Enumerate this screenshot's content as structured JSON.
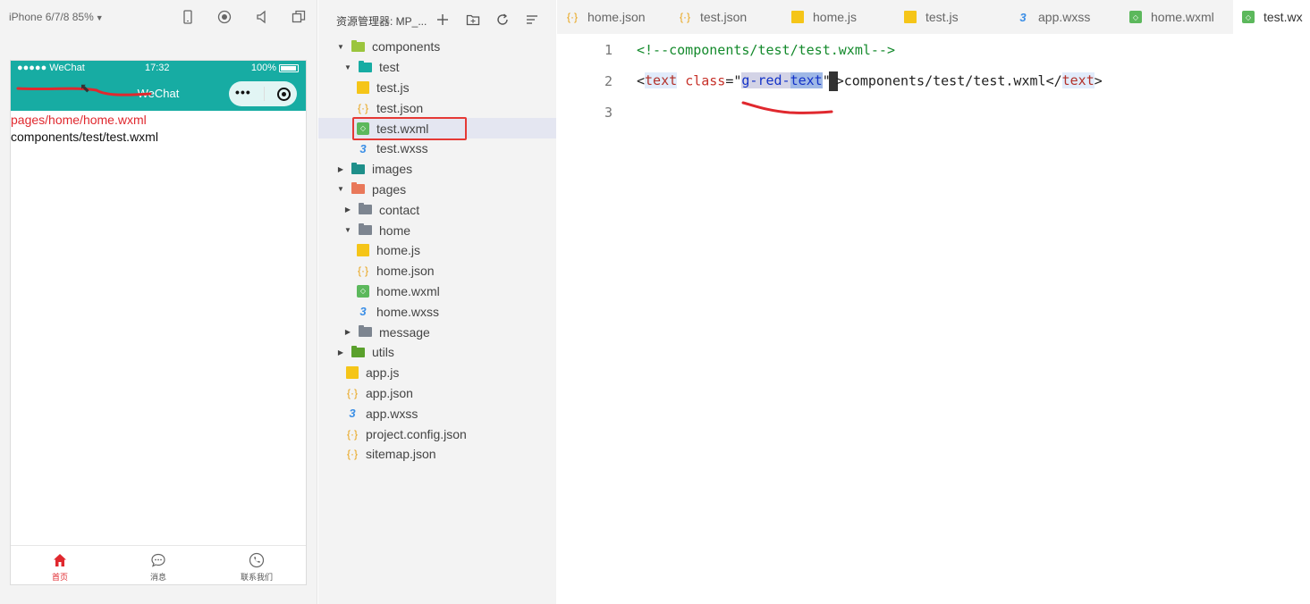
{
  "simulator": {
    "device": "iPhone 6/7/8 85%",
    "status_bar": {
      "carrier": "●●●●● WeChat",
      "time": "17:32",
      "battery": "100%"
    },
    "nav_title": "WeChat",
    "content_lines": [
      "pages/home/home.wxml",
      "components/test/test.wxml"
    ],
    "tabbar": [
      {
        "label": "首页",
        "icon": "home-icon",
        "active": true
      },
      {
        "label": "消息",
        "icon": "chat-bubble-icon",
        "active": false
      },
      {
        "label": "联系我们",
        "icon": "phone-icon",
        "active": false
      }
    ],
    "colors": {
      "nav_bg": "#17aca3",
      "active_tab": "#e0282e",
      "red_text": "#e0282e"
    }
  },
  "explorer": {
    "title": "资源管理器: MP_...",
    "tree": [
      {
        "label": "components",
        "type": "folder",
        "folder_color": "#9bc53d",
        "depth": 0,
        "twisty": "open"
      },
      {
        "label": "test",
        "type": "folder",
        "folder_color": "#17aca3",
        "depth": 1,
        "twisty": "open"
      },
      {
        "label": "test.js",
        "type": "js",
        "depth": 2
      },
      {
        "label": "test.json",
        "type": "json",
        "depth": 2
      },
      {
        "label": "test.wxml",
        "type": "wxml",
        "depth": 2,
        "selected": true
      },
      {
        "label": "test.wxss",
        "type": "wxss",
        "depth": 2
      },
      {
        "label": "images",
        "type": "folder",
        "folder_color": "#1e8f8a",
        "depth": 0,
        "twisty": "closed"
      },
      {
        "label": "pages",
        "type": "folder",
        "folder_color": "#e9785a",
        "depth": 0,
        "twisty": "open"
      },
      {
        "label": "contact",
        "type": "folder",
        "folder_color": "#7d8590",
        "depth": 1,
        "twisty": "closed"
      },
      {
        "label": "home",
        "type": "folder",
        "folder_color": "#7d8590",
        "depth": 1,
        "twisty": "open"
      },
      {
        "label": "home.js",
        "type": "js",
        "depth": 2
      },
      {
        "label": "home.json",
        "type": "json",
        "depth": 2
      },
      {
        "label": "home.wxml",
        "type": "wxml",
        "depth": 2
      },
      {
        "label": "home.wxss",
        "type": "wxss",
        "depth": 2
      },
      {
        "label": "message",
        "type": "folder",
        "folder_color": "#7d8590",
        "depth": 1,
        "twisty": "closed"
      },
      {
        "label": "utils",
        "type": "folder",
        "folder_color": "#5aa02c",
        "depth": 0,
        "twisty": "closed"
      },
      {
        "label": "app.js",
        "type": "js",
        "depth": 0
      },
      {
        "label": "app.json",
        "type": "json",
        "depth": 0
      },
      {
        "label": "app.wxss",
        "type": "wxss",
        "depth": 0
      },
      {
        "label": "project.config.json",
        "type": "json",
        "depth": 0
      },
      {
        "label": "sitemap.json",
        "type": "json",
        "depth": 0
      }
    ]
  },
  "editor": {
    "tabs": [
      {
        "label": "home.json",
        "type": "json",
        "active": false
      },
      {
        "label": "test.json",
        "type": "json",
        "active": false
      },
      {
        "label": "home.js",
        "type": "js",
        "active": false
      },
      {
        "label": "test.js",
        "type": "js",
        "active": false
      },
      {
        "label": "app.wxss",
        "type": "wxss",
        "active": false
      },
      {
        "label": "home.wxml",
        "type": "wxml",
        "active": false
      },
      {
        "label": "test.wx",
        "type": "wxml",
        "active": true
      }
    ],
    "lines": [
      {
        "number": "1",
        "comment": "<!--components/test/test.wxml-->"
      },
      {
        "number": "2",
        "open_bracket": "<",
        "tag": "text",
        "attr": "class",
        "eq_quote": "=\"",
        "str_a": "g-red-",
        "str_b": "text",
        "close_quote": "\"",
        "gt": ">",
        "inner": "components/test/test.wxml",
        "close_open": "</",
        "close_tag": "text",
        "close_gt": ">"
      },
      {
        "number": "3"
      }
    ]
  }
}
